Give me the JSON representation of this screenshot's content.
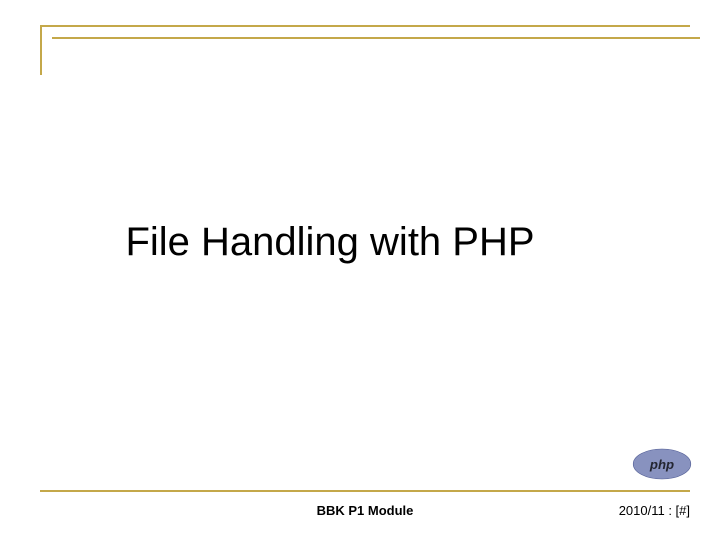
{
  "slide": {
    "title": "File Handling with PHP"
  },
  "footer": {
    "module": "BBK P1 Module",
    "date_page": "2010/11 : [#]"
  },
  "logo": {
    "name": "php"
  }
}
